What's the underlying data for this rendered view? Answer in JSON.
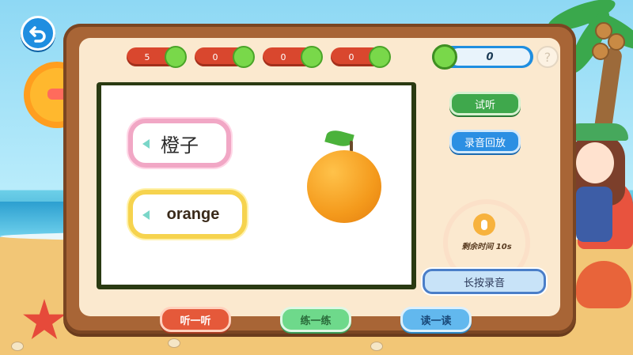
{
  "scores": [
    {
      "value": "5"
    },
    {
      "value": "0"
    },
    {
      "value": "0"
    },
    {
      "value": "0"
    }
  ],
  "timer": {
    "value": "0"
  },
  "help": {
    "label": "?"
  },
  "card": {
    "word_cn": "橙子",
    "word_en": "orange",
    "image": "orange-fruit"
  },
  "side": {
    "try_label": "试听",
    "playback_label": "录音回放",
    "remaining_label": "剩余时间 10s",
    "record_label": "长按录音"
  },
  "bottom": {
    "listen_label": "听一听",
    "practice_label": "练一练",
    "read_label": "读一读"
  },
  "colors": {
    "wood": "#a86536",
    "panel": "#fbe9cf",
    "green_button": "#3fa84c",
    "blue_button": "#2b8fe3",
    "score_red": "#d9472e"
  },
  "icons": [
    "back-arrow-icon",
    "speaker-icon",
    "microphone-icon",
    "help-icon"
  ]
}
